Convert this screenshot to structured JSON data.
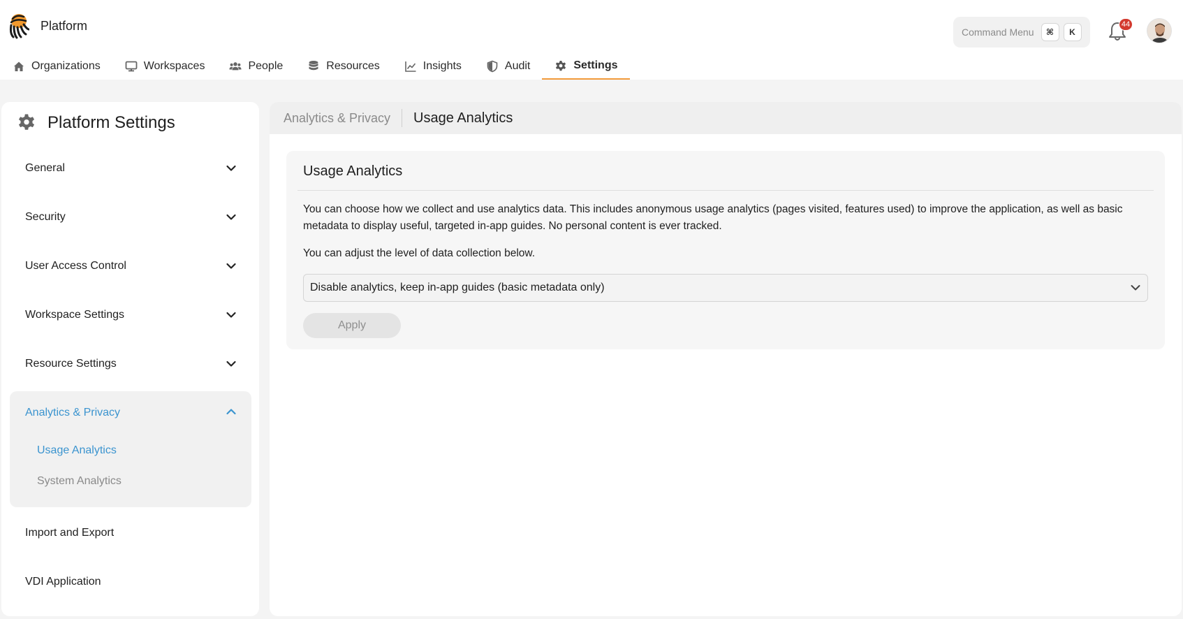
{
  "app": {
    "name": "Platform",
    "logo_icon": "octopus-logo-icon"
  },
  "header": {
    "command_menu": {
      "label": "Command Menu",
      "keys": [
        "⌘",
        "K"
      ]
    },
    "notifications": {
      "icon": "bell-icon",
      "count": "44"
    },
    "avatar": {
      "icon": "user-avatar"
    }
  },
  "nav": {
    "items": [
      {
        "label": "Organizations",
        "icon": "home-icon",
        "active": false
      },
      {
        "label": "Workspaces",
        "icon": "monitor-icon",
        "active": false
      },
      {
        "label": "People",
        "icon": "people-icon",
        "active": false
      },
      {
        "label": "Resources",
        "icon": "database-icon",
        "active": false
      },
      {
        "label": "Insights",
        "icon": "chart-line-icon",
        "active": false
      },
      {
        "label": "Audit",
        "icon": "shield-icon",
        "active": false
      },
      {
        "label": "Settings",
        "icon": "gear-icon",
        "active": true
      }
    ],
    "accent_color": "#f29a3a"
  },
  "sidebar": {
    "title": "Platform Settings",
    "items": [
      {
        "label": "General"
      },
      {
        "label": "Security"
      },
      {
        "label": "User Access Control"
      },
      {
        "label": "Workspace Settings"
      },
      {
        "label": "Resource Settings"
      }
    ],
    "expanded_group": {
      "label": "Analytics & Privacy",
      "children": [
        {
          "label": "Usage Analytics",
          "active": true
        },
        {
          "label": "System Analytics",
          "active": false
        }
      ]
    },
    "items_after": [
      {
        "label": "Import and Export"
      },
      {
        "label": "VDI Application"
      }
    ],
    "link_color": "#3b94cf"
  },
  "breadcrumb": {
    "parent": "Analytics & Privacy",
    "current": "Usage Analytics"
  },
  "card": {
    "title": "Usage Analytics",
    "description": "You can choose how we collect and use analytics data. This includes anonymous usage analytics (pages visited, features used) to improve the application, as well as basic metadata to display useful, targeted in-app guides. No personal content is ever tracked.",
    "instruction": "You can adjust the level of data collection below.",
    "select_value": "Disable analytics, keep in-app guides (basic metadata only)",
    "apply_label": "Apply"
  }
}
